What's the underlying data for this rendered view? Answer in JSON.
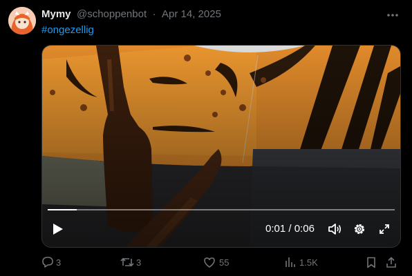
{
  "tweet": {
    "author_name": "Mymy",
    "handle": "@schoppenbot",
    "separator": "·",
    "date": "Apr 14, 2025",
    "hashtag": "#ongezellig"
  },
  "video": {
    "current_time": "0:01",
    "time_separator": "/",
    "duration": "0:06",
    "progress_fraction": 0.083
  },
  "actions": {
    "replies": "3",
    "reposts": "3",
    "likes": "55",
    "views": "1.5K"
  },
  "colors": {
    "accent": "#1d9bf0",
    "muted": "#71767b",
    "text": "#e7e9ea"
  },
  "icons": [
    "more-icon",
    "play-icon",
    "volume-icon",
    "settings-icon",
    "fullscreen-icon",
    "reply-icon",
    "repost-icon",
    "like-icon",
    "views-icon",
    "bookmark-icon",
    "share-icon"
  ]
}
